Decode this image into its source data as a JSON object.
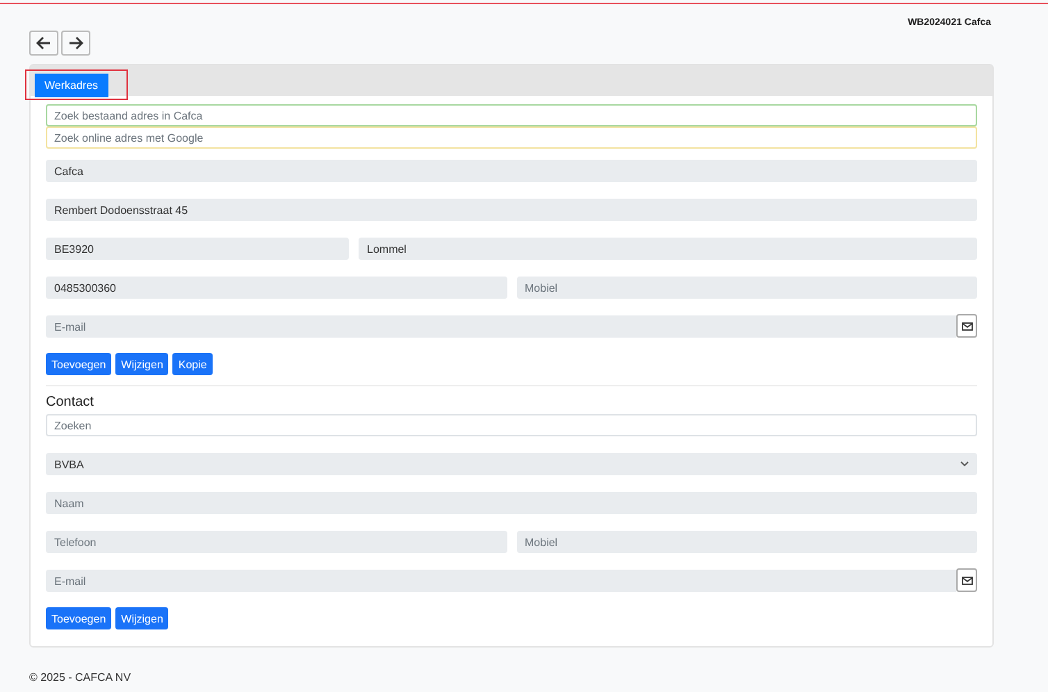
{
  "header": {
    "reference": "WB2024021 Cafca"
  },
  "tabs": [
    {
      "label": "Werkadres",
      "selected": true,
      "highlighted": true
    }
  ],
  "address": {
    "rows": [
      {
        "kind": "search",
        "fields": [
          {
            "kind": "input",
            "placeholder": "Zoek bestaand adres in Cafca",
            "color": "#a8d8a0"
          }
        ]
      },
      {
        "kind": "search",
        "fields": [
          {
            "kind": "input",
            "placeholder": "Zoek online adres met Google",
            "color": "#f3e3a0"
          }
        ]
      },
      {
        "kind": "full",
        "fields": [
          {
            "kind": "input",
            "value": "Cafca"
          }
        ]
      },
      {
        "kind": "full",
        "fields": [
          {
            "kind": "input",
            "value": "Rembert Dodoensstraat 45"
          }
        ]
      },
      {
        "kind": "third",
        "fields": [
          {
            "kind": "input",
            "value": "BE3920"
          },
          {
            "kind": "input",
            "value": "Lommel"
          }
        ]
      },
      {
        "kind": "half",
        "fields": [
          {
            "kind": "input",
            "value": "0485300360"
          },
          {
            "kind": "input",
            "placeholder": "Mobiel"
          }
        ]
      },
      {
        "kind": "full",
        "fields": [
          {
            "kind": "email",
            "placeholder": "E-mail"
          }
        ]
      }
    ],
    "buttons": [
      "Toevoegen",
      "Wijzigen",
      "Kopie"
    ]
  },
  "contact": {
    "title": "Contact",
    "rows": [
      {
        "kind": "plain",
        "fields": [
          {
            "kind": "input",
            "placeholder": "Zoeken"
          }
        ]
      },
      {
        "kind": "full",
        "fields": [
          {
            "kind": "select",
            "value": "BVBA"
          }
        ]
      },
      {
        "kind": "full",
        "fields": [
          {
            "kind": "input",
            "placeholder": "Naam"
          }
        ]
      },
      {
        "kind": "half",
        "fields": [
          {
            "kind": "input",
            "placeholder": "Telefoon"
          },
          {
            "kind": "input",
            "placeholder": "Mobiel"
          }
        ]
      },
      {
        "kind": "full",
        "fields": [
          {
            "kind": "email",
            "placeholder": "E-mail"
          }
        ]
      }
    ],
    "buttons": [
      "Toevoegen",
      "Wijzigen"
    ]
  },
  "footer": {
    "text": "© 2025 - CAFCA NV"
  }
}
